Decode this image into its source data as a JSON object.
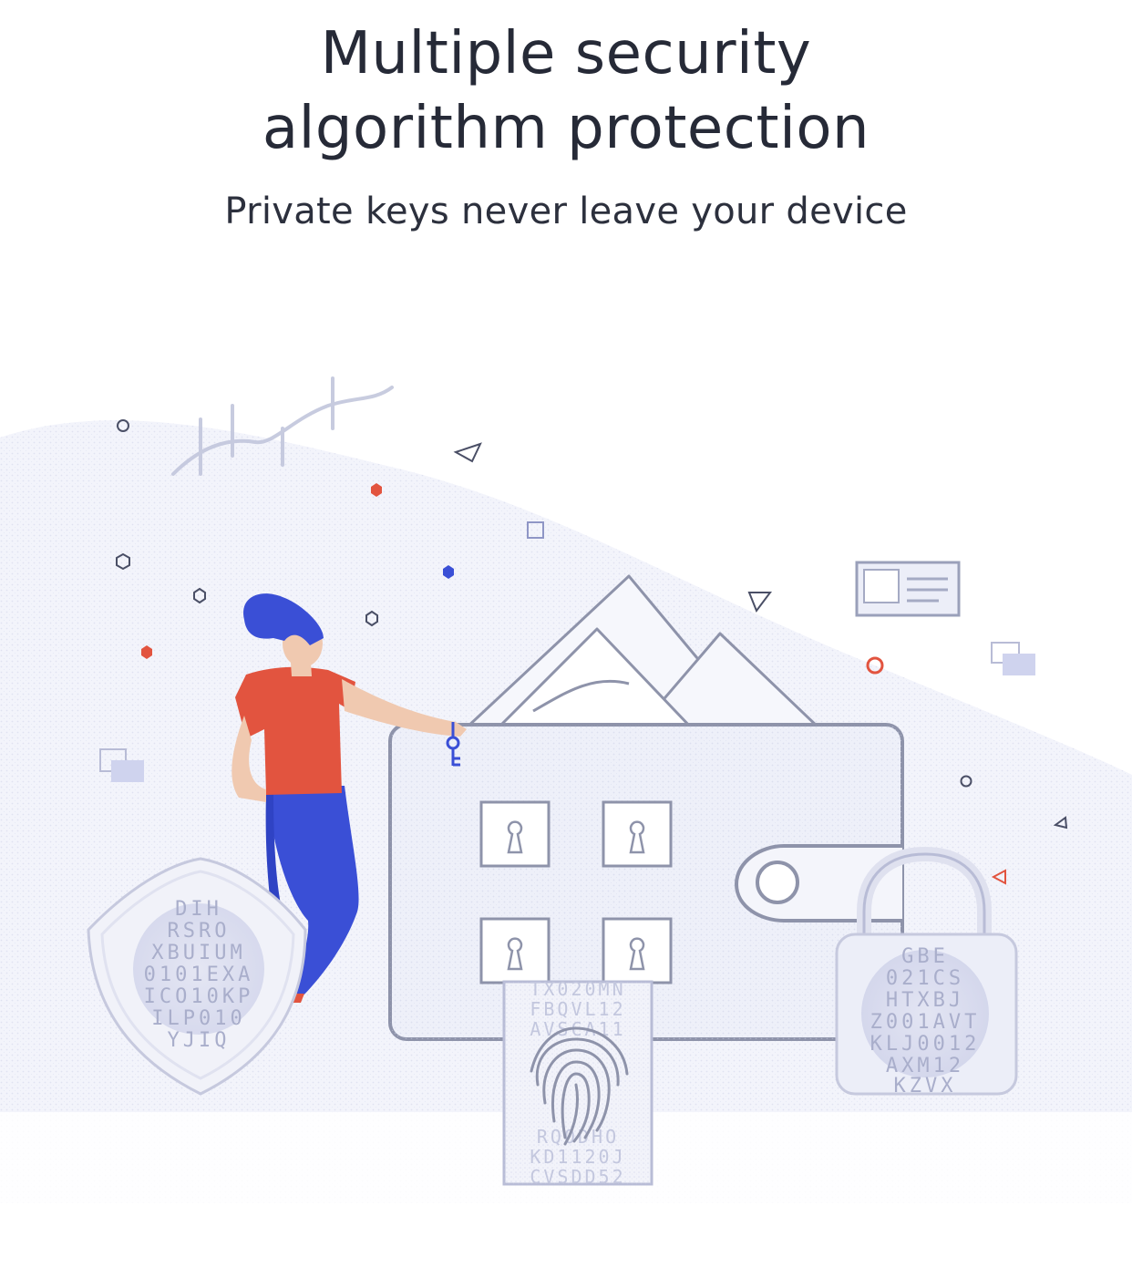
{
  "header": {
    "title_line1": "Multiple security",
    "title_line2": "algorithm protection",
    "subtitle": "Private keys never leave your device"
  },
  "illustration": {
    "shield_code": [
      "DIH",
      "RSRO",
      "XBUIUM",
      "0101EXA",
      "ICO10KP",
      "ILP010",
      "YJIQ"
    ],
    "lock_code": [
      "GBE",
      "021CS",
      "HTXBJ",
      "Z001AVT",
      "KLJ0012",
      "AXM12",
      "KZVX"
    ],
    "fingerprint_code": [
      "TX020MN",
      "FBQVL12",
      "AVSCA11",
      "RQ0DHO",
      "KD1120J",
      "CVSDD52"
    ],
    "colors": {
      "accent_blue": "#3a4fd6",
      "accent_red": "#e2543f",
      "line_gray": "#8e93aa",
      "tint": "#eceef8"
    }
  }
}
